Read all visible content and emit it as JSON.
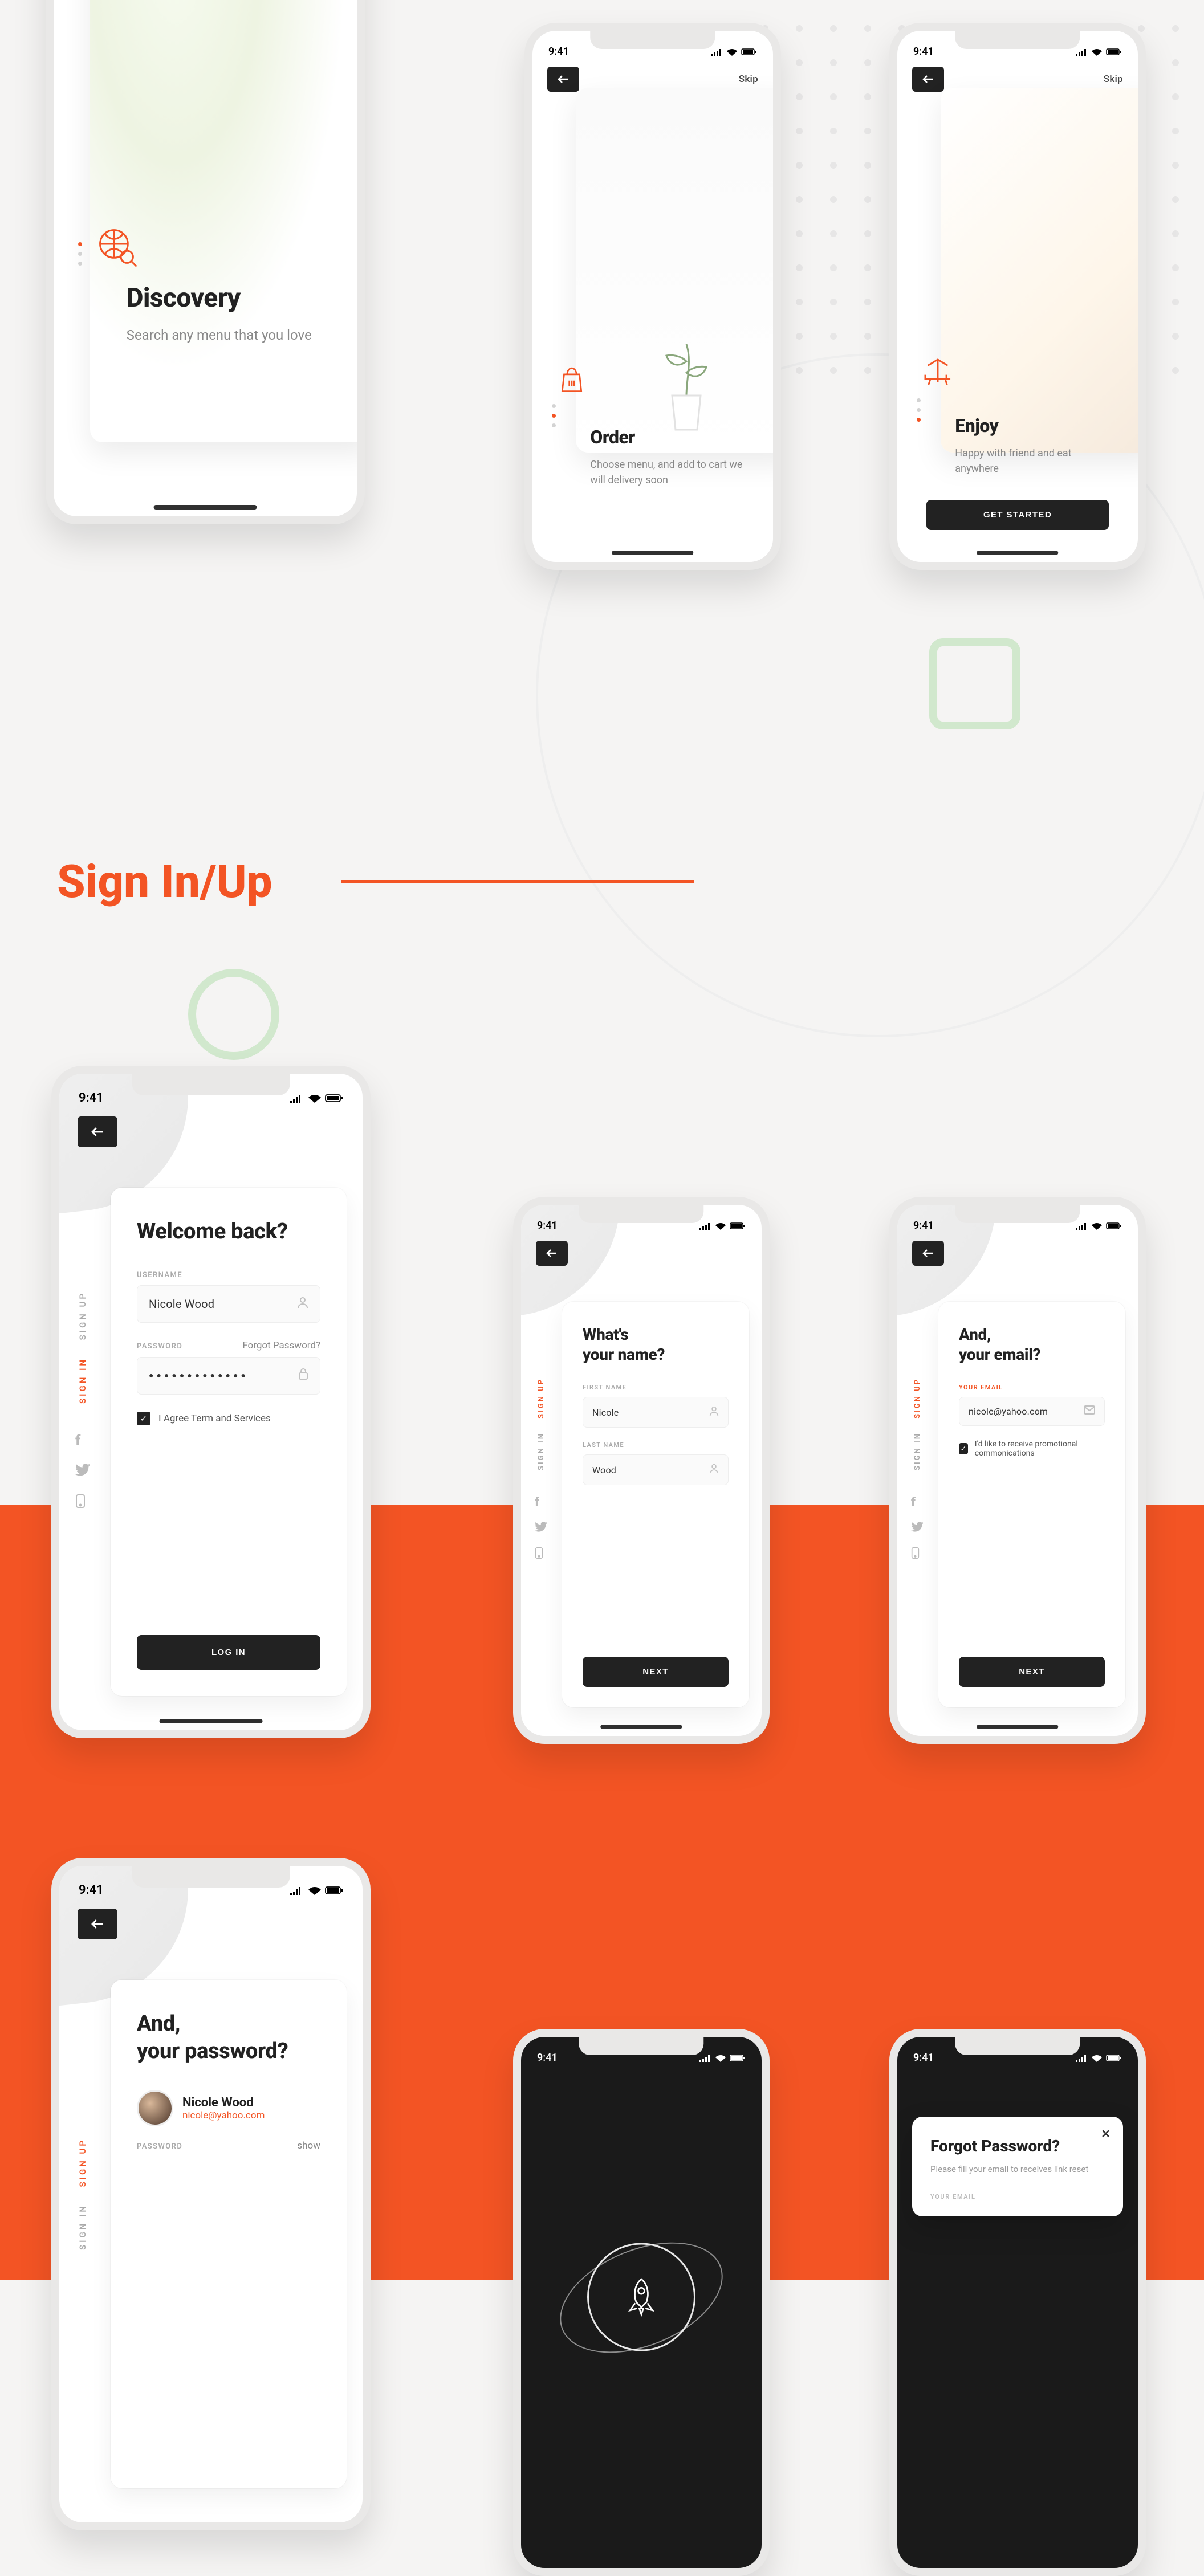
{
  "status": {
    "time": "9:41"
  },
  "common": {
    "skip": "Skip",
    "next_btn": "NEXT",
    "login_btn": "LOG IN",
    "get_started": "GET STARTED"
  },
  "section_heading": "Sign In/Up",
  "onboarding": {
    "discovery": {
      "title": "Discovery",
      "subtitle": "Search any menu that you love"
    },
    "order": {
      "title": "Order",
      "subtitle": "Choose menu, and add to cart we will delivery soon"
    },
    "enjoy": {
      "title": "Enjoy",
      "subtitle": "Happy with friend and eat anywhere"
    }
  },
  "side_tabs": {
    "sign_up": "SIGN UP",
    "sign_in": "SIGN IN"
  },
  "signin": {
    "heading": "Welcome back?",
    "username_label": "USERNAME",
    "username_value": "Nicole Wood",
    "password_label": "PASSWORD",
    "password_masked": "●●●●●●●●●●●●●",
    "forgot_inline": "Forgot Password?",
    "terms": "I Agree Term and Services"
  },
  "signup_name": {
    "heading": "What's\nyour name?",
    "first_label": "FIRST NAME",
    "first_value": "Nicole",
    "last_label": "LAST NAME",
    "last_value": "Wood"
  },
  "signup_email": {
    "heading": "And,\nyour email?",
    "label": "YOUR EMAIL",
    "value": "nicole@yahoo.com",
    "promo": "I'd like to receive promotional commonications"
  },
  "signup_password": {
    "heading": "And,\nyour password?",
    "user_name": "Nicole Wood",
    "user_email": "nicole@yahoo.com",
    "password_label": "PASSWORD",
    "show": "show"
  },
  "forgot": {
    "heading": "Forgot Password?",
    "subtitle": "Please fill your email to receives link reset",
    "label": "YOUR EMAIL"
  }
}
